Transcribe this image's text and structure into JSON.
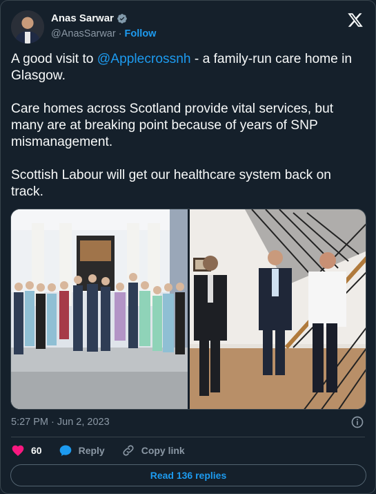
{
  "author": {
    "name": "Anas Sarwar",
    "handle": "@AnasSarwar",
    "separator": "·",
    "follow_label": "Follow"
  },
  "tweet": {
    "line1_prefix": "A good visit to ",
    "line1_mention": "@Applecrossnh",
    "line1_suffix": " - a family-run care home in Glasgow.",
    "paragraph2": "Care homes across Scotland provide vital services, but many are at breaking point because of years of SNP mismanagement.",
    "paragraph3": "Scottish Labour will get our healthcare system back on track."
  },
  "meta": {
    "time": "5:27 PM · Jun 2, 2023"
  },
  "actions": {
    "likes": "60",
    "reply_label": "Reply",
    "copy_label": "Copy link"
  },
  "read_replies_label": "Read 136 replies",
  "colors": {
    "background": "#15202b",
    "accent": "#1d9bf0",
    "like": "#f91880",
    "muted": "#8b98a5"
  },
  "icons": [
    "verified-badge-icon",
    "x-logo-icon",
    "info-icon",
    "heart-icon",
    "reply-icon",
    "link-icon"
  ]
}
